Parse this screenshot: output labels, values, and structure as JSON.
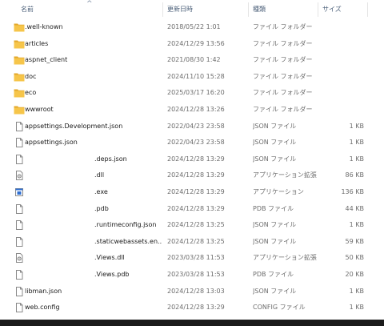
{
  "columns": {
    "name": "名前",
    "date": "更新日時",
    "type": "種類",
    "size": "サイズ"
  },
  "files": [
    {
      "name": ".well-known",
      "date": "2018/05/22 1:01",
      "type": "ファイル フォルダー",
      "size": "",
      "icon": "folder-icon"
    },
    {
      "name": "articles",
      "date": "2024/12/29 13:56",
      "type": "ファイル フォルダー",
      "size": "",
      "icon": "folder-icon"
    },
    {
      "name": "aspnet_client",
      "date": "2021/08/30 1:42",
      "type": "ファイル フォルダー",
      "size": "",
      "icon": "folder-icon"
    },
    {
      "name": "doc",
      "date": "2024/11/10 15:28",
      "type": "ファイル フォルダー",
      "size": "",
      "icon": "folder-icon"
    },
    {
      "name": "eco",
      "date": "2025/03/17 16:20",
      "type": "ファイル フォルダー",
      "size": "",
      "icon": "folder-icon"
    },
    {
      "name": "wwwroot",
      "date": "2024/12/28 13:26",
      "type": "ファイル フォルダー",
      "size": "",
      "icon": "folder-icon"
    },
    {
      "name": "appsettings.Development.json",
      "date": "2022/04/23 23:58",
      "type": "JSON ファイル",
      "size": "1 KB",
      "icon": "file-icon"
    },
    {
      "name": "appsettings.json",
      "date": "2022/04/23 23:58",
      "type": "JSON ファイル",
      "size": "1 KB",
      "icon": "file-icon"
    },
    {
      "name": ".deps.json",
      "date": "2024/12/28 13:29",
      "type": "JSON ファイル",
      "size": "1 KB",
      "icon": "file-icon",
      "indent": true
    },
    {
      "name": ".dll",
      "date": "2024/12/28 13:29",
      "type": "アプリケーション拡張",
      "size": "86 KB",
      "icon": "dll-file-icon",
      "indent": true
    },
    {
      "name": ".exe",
      "date": "2024/12/28 13:29",
      "type": "アプリケーション",
      "size": "136 KB",
      "icon": "exe-file-icon",
      "indent": true
    },
    {
      "name": ".pdb",
      "date": "2024/12/28 13:29",
      "type": "PDB ファイル",
      "size": "44 KB",
      "icon": "file-icon",
      "indent": true
    },
    {
      "name": ".runtimeconfig.json",
      "date": "2024/12/28 13:25",
      "type": "JSON ファイル",
      "size": "1 KB",
      "icon": "file-icon",
      "indent": true
    },
    {
      "name": ".staticwebassets.en...",
      "date": "2024/12/28 13:25",
      "type": "JSON ファイル",
      "size": "59 KB",
      "icon": "file-icon",
      "indent": true
    },
    {
      "name": ".Views.dll",
      "date": "2023/03/28 11:53",
      "type": "アプリケーション拡張",
      "size": "50 KB",
      "icon": "dll-file-icon",
      "indent": true
    },
    {
      "name": ".Views.pdb",
      "date": "2023/03/28 11:53",
      "type": "PDB ファイル",
      "size": "20 KB",
      "icon": "file-icon",
      "indent": true
    },
    {
      "name": "libman.json",
      "date": "2024/12/28 13:03",
      "type": "JSON ファイル",
      "size": "1 KB",
      "icon": "file-icon"
    },
    {
      "name": "web.config",
      "date": "2024/12/28 13:29",
      "type": "CONFIG ファイル",
      "size": "1 KB",
      "icon": "file-icon"
    }
  ],
  "colors": {
    "folder": "#f6c54a",
    "folder_dark": "#e3a82b",
    "exe_blue": "#2f6fd1",
    "header_text": "#4c607a",
    "taskbar": "#1b1b1b"
  }
}
